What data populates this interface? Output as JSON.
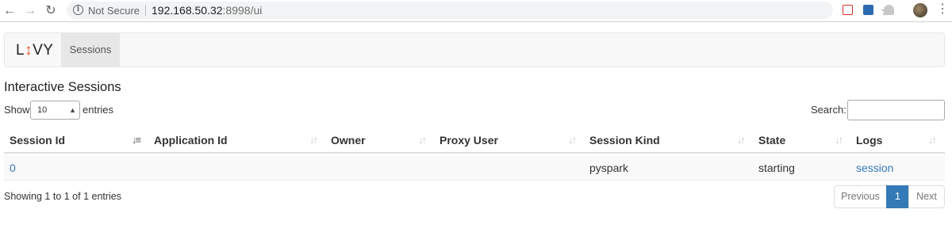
{
  "browser": {
    "security_label": "Not Secure",
    "url_host": "192.168.50.32",
    "url_rest": ":8998/ui"
  },
  "navbar": {
    "brand_left": "L",
    "brand_arrow": "↕",
    "brand_right": "VY",
    "tab_sessions": "Sessions"
  },
  "page": {
    "title": "Interactive Sessions"
  },
  "controls": {
    "show_label": "Show",
    "page_length": "10",
    "entries_label": "entries",
    "search_label": "Search:",
    "search_value": ""
  },
  "table": {
    "headers": [
      "Session Id",
      "Application Id",
      "Owner",
      "Proxy User",
      "Session Kind",
      "State",
      "Logs"
    ],
    "rows": [
      {
        "session_id": "0",
        "application_id": "",
        "owner": "",
        "proxy_user": "",
        "session_kind": "pyspark",
        "state": "starting",
        "logs": "session"
      }
    ]
  },
  "footer": {
    "info": "Showing 1 to 1 of 1 entries",
    "previous": "Previous",
    "current_page": "1",
    "next": "Next"
  },
  "colors": {
    "link": "#337ab7",
    "brand_accent": "#e8531f",
    "active_page": "#337ab7"
  }
}
